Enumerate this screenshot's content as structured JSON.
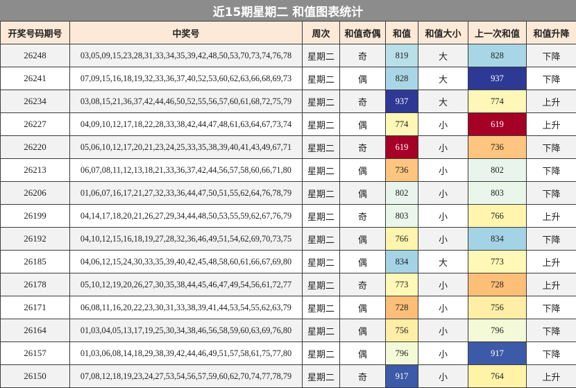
{
  "title": "近15期星期二 和值图表统计",
  "headers": [
    "开奖号码期号",
    "中奖号",
    "周次",
    "和值奇偶",
    "和值",
    "和值大小",
    "上一次和值",
    "和值升降"
  ],
  "colors": {
    "c819": "#b9dfe9",
    "c828": "#a9d6e6",
    "c937": "#2e3995",
    "c774": "#fff7b7",
    "c619": "#a50026",
    "c736": "#fdc57f",
    "c802": "#e9f5ec",
    "c803": "#eaf6ea",
    "c766": "#fff5ae",
    "c834": "#a4d3e6",
    "c773": "#fff8b6",
    "c728": "#fdbe78",
    "c756": "#ffeea5",
    "c796": "#f4fad8",
    "c917": "#3d5aa8",
    "c764": "#fff3a8"
  },
  "rows": [
    {
      "period": "26248",
      "numbers": "03,05,09,15,23,28,31,33,34,35,39,42,48,50,53,70,73,74,76,78",
      "weekday": "星期二",
      "parity": "奇",
      "sum": "819",
      "sum_color": "#b9dfe9",
      "size": "大",
      "prev_sum": "828",
      "prev_color": "#a9d6e6",
      "trend": "下降"
    },
    {
      "period": "26241",
      "numbers": "07,09,15,16,18,19,32,33,36,37,40,52,53,60,62,63,66,68,69,73",
      "weekday": "星期二",
      "parity": "偶",
      "sum": "828",
      "sum_color": "#a9d6e6",
      "size": "大",
      "prev_sum": "937",
      "prev_color": "#2e3995",
      "trend": "下降"
    },
    {
      "period": "26234",
      "numbers": "03,08,15,21,36,37,42,44,46,50,52,55,56,57,60,61,68,72,75,79",
      "weekday": "星期二",
      "parity": "奇",
      "sum": "937",
      "sum_color": "#2e3995",
      "size": "大",
      "prev_sum": "774",
      "prev_color": "#fff7b7",
      "trend": "上升"
    },
    {
      "period": "26227",
      "numbers": "04,09,10,12,17,18,22,28,33,38,42,44,47,48,61,63,64,67,73,74",
      "weekday": "星期二",
      "parity": "偶",
      "sum": "774",
      "sum_color": "#fff7b7",
      "size": "小",
      "prev_sum": "619",
      "prev_color": "#a50026",
      "trend": "上升"
    },
    {
      "period": "26220",
      "numbers": "05,06,10,12,17,20,21,23,24,25,33,35,38,39,40,41,43,49,67,71",
      "weekday": "星期二",
      "parity": "奇",
      "sum": "619",
      "sum_color": "#a50026",
      "size": "小",
      "prev_sum": "736",
      "prev_color": "#fdc57f",
      "trend": "下降"
    },
    {
      "period": "26213",
      "numbers": "06,07,08,11,12,13,18,21,33,36,37,42,44,56,57,58,60,66,71,80",
      "weekday": "星期二",
      "parity": "偶",
      "sum": "736",
      "sum_color": "#fdc57f",
      "size": "小",
      "prev_sum": "802",
      "prev_color": "#e9f5ec",
      "trend": "下降"
    },
    {
      "period": "26206",
      "numbers": "01,06,07,16,17,21,27,32,33,36,44,47,50,51,55,62,64,76,78,79",
      "weekday": "星期二",
      "parity": "偶",
      "sum": "802",
      "sum_color": "#e9f5ec",
      "size": "小",
      "prev_sum": "803",
      "prev_color": "#eaf6ea",
      "trend": "下降"
    },
    {
      "period": "26199",
      "numbers": "04,14,17,18,20,21,26,27,29,34,44,48,50,53,55,59,62,67,76,79",
      "weekday": "星期二",
      "parity": "奇",
      "sum": "803",
      "sum_color": "#eaf6ea",
      "size": "小",
      "prev_sum": "766",
      "prev_color": "#fff5ae",
      "trend": "上升"
    },
    {
      "period": "26192",
      "numbers": "04,10,12,15,16,18,19,27,28,32,36,46,49,51,54,62,69,70,73,75",
      "weekday": "星期二",
      "parity": "偶",
      "sum": "766",
      "sum_color": "#fff5ae",
      "size": "小",
      "prev_sum": "834",
      "prev_color": "#a4d3e6",
      "trend": "下降"
    },
    {
      "period": "26185",
      "numbers": "04,06,12,15,24,30,33,35,39,40,42,45,48,58,60,61,66,67,69,80",
      "weekday": "星期二",
      "parity": "偶",
      "sum": "834",
      "sum_color": "#a4d3e6",
      "size": "大",
      "prev_sum": "773",
      "prev_color": "#fff8b6",
      "trend": "上升"
    },
    {
      "period": "26178",
      "numbers": "05,10,12,19,20,26,27,30,35,38,44,45,46,47,49,54,56,61,72,77",
      "weekday": "星期二",
      "parity": "奇",
      "sum": "773",
      "sum_color": "#fff8b6",
      "size": "小",
      "prev_sum": "728",
      "prev_color": "#fdbe78",
      "trend": "上升"
    },
    {
      "period": "26171",
      "numbers": "06,08,11,16,20,22,23,30,31,33,38,39,41,44,53,54,55,62,63,79",
      "weekday": "星期二",
      "parity": "偶",
      "sum": "728",
      "sum_color": "#fdbe78",
      "size": "小",
      "prev_sum": "756",
      "prev_color": "#ffeea5",
      "trend": "下降"
    },
    {
      "period": "26164",
      "numbers": "01,03,04,05,13,17,19,25,30,34,38,46,56,58,59,60,63,69,76,80",
      "weekday": "星期二",
      "parity": "偶",
      "sum": "756",
      "sum_color": "#ffeea5",
      "size": "小",
      "prev_sum": "796",
      "prev_color": "#f4fad8",
      "trend": "下降"
    },
    {
      "period": "26157",
      "numbers": "01,03,06,08,14,18,29,38,39,42,44,46,49,51,57,58,61,75,77,80",
      "weekday": "星期二",
      "parity": "偶",
      "sum": "796",
      "sum_color": "#f4fad8",
      "size": "小",
      "prev_sum": "917",
      "prev_color": "#3d5aa8",
      "trend": "下降"
    },
    {
      "period": "26150",
      "numbers": "07,08,12,18,19,23,24,27,53,54,56,57,59,60,62,70,74,77,78,79",
      "weekday": "星期二",
      "parity": "奇",
      "sum": "917",
      "sum_color": "#3d5aa8",
      "size": "小",
      "prev_sum": "764",
      "prev_color": "#fff3a8",
      "trend": "上升"
    }
  ]
}
